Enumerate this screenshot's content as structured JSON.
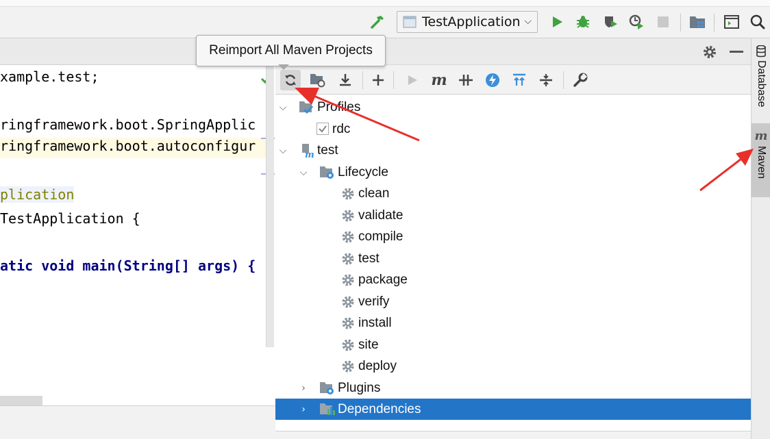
{
  "run_config": {
    "label": "TestApplication"
  },
  "tooltip": {
    "text": "Reimport All Maven Projects"
  },
  "editor": {
    "lines": [
      "xample.test;",
      "ringframework.boot.SpringApplic",
      "ringframework.boot.autoconfigur",
      "plication",
      "TestApplication {",
      "atic void main(String[] args) {"
    ]
  },
  "maven_tree": {
    "profiles": "Profiles",
    "profile_rdc": "rdc",
    "project": "test",
    "lifecycle": "Lifecycle",
    "phases": [
      "clean",
      "validate",
      "compile",
      "test",
      "package",
      "verify",
      "install",
      "site",
      "deploy"
    ],
    "plugins": "Plugins",
    "dependencies": "Dependencies"
  },
  "right_strip": {
    "database": "Database",
    "maven": "Maven",
    "maven_icon_glyph": "m"
  },
  "colors": {
    "selection": "#2375c8",
    "annotation_arrow": "#e8302a",
    "run_green": "#3fa33f"
  },
  "icons": {
    "toolbar": [
      "hammer-icon",
      "run-icon",
      "debug-icon",
      "coverage-icon",
      "profile-icon",
      "stop-icon",
      "project-structure-icon",
      "terminal-layout-icon",
      "search-icon"
    ],
    "maven_toolbar": [
      "reimport-icon",
      "generate-sources-icon",
      "download-icon",
      "add-icon",
      "run-maven-icon",
      "execute-goal-icon",
      "toggle-offline-icon",
      "skip-tests-icon",
      "show-dependencies-icon",
      "collapse-all-icon",
      "settings-wrench-icon"
    ]
  }
}
